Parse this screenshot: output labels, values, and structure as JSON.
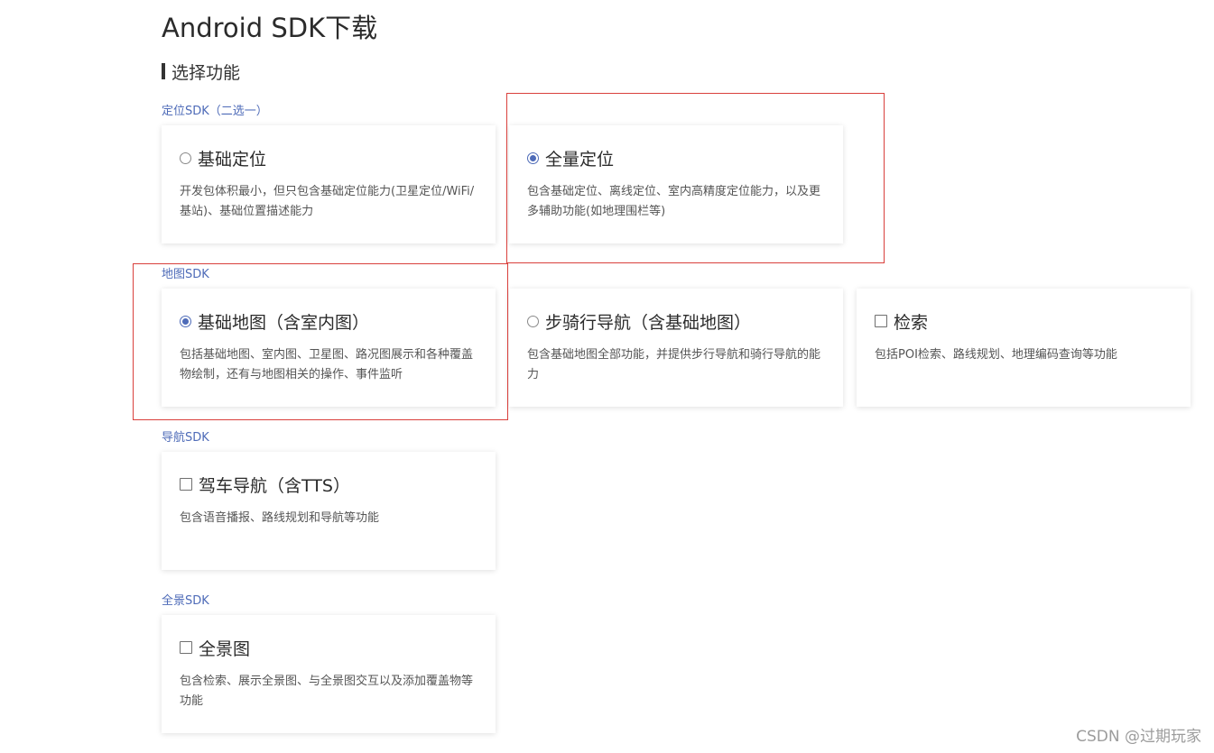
{
  "page": {
    "title": "Android SDK下载"
  },
  "section": {
    "title": "选择功能"
  },
  "groups": {
    "location": {
      "label": "定位SDK（二选一）",
      "cards": [
        {
          "title": "基础定位",
          "desc": "开发包体积最小，但只包含基础定位能力(卫星定位/WiFi/基站)、基础位置描述能力",
          "control": "radio",
          "checked": false
        },
        {
          "title": "全量定位",
          "desc": "包含基础定位、离线定位、室内高精度定位能力，以及更多辅助功能(如地理围栏等)",
          "control": "radio",
          "checked": true
        }
      ]
    },
    "map": {
      "label": "地图SDK",
      "cards": [
        {
          "title": "基础地图（含室内图）",
          "desc": "包括基础地图、室内图、卫星图、路况图展示和各种覆盖物绘制，还有与地图相关的操作、事件监听",
          "control": "radio",
          "checked": true
        },
        {
          "title": "步骑行导航（含基础地图）",
          "desc": "包含基础地图全部功能，并提供步行导航和骑行导航的能力",
          "control": "radio",
          "checked": false
        },
        {
          "title": "检索",
          "desc": "包括POI检索、路线规划、地理编码查询等功能",
          "control": "checkbox",
          "checked": false
        }
      ]
    },
    "navigation": {
      "label": "导航SDK",
      "cards": [
        {
          "title": "驾车导航（含TTS）",
          "desc": "包含语音播报、路线规划和导航等功能",
          "control": "checkbox",
          "checked": false
        }
      ]
    },
    "panorama": {
      "label": "全景SDK",
      "cards": [
        {
          "title": "全景图",
          "desc": "包含检索、展示全景图、与全景图交互以及添加覆盖物等功能",
          "control": "checkbox",
          "checked": false
        }
      ]
    }
  },
  "watermark": "CSDN @过期玩家",
  "colors": {
    "accent": "#4e6bb8",
    "annotation": "#d9403c",
    "text": "#333333"
  }
}
